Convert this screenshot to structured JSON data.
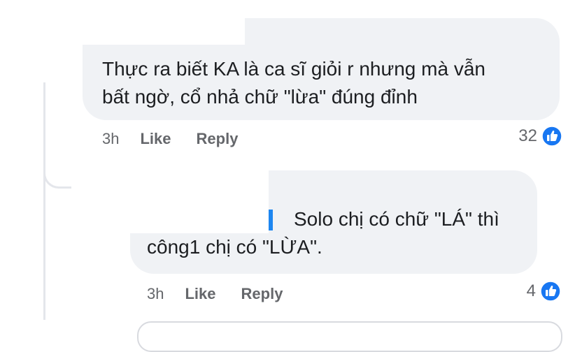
{
  "comments": [
    {
      "lines": [
        "Thực ra biết KA là ca sĩ giỏi r nhưng mà vẫn",
        "bất ngờ, cổ nhả chữ \"lừa\" đúng đỉnh"
      ],
      "time": "3h",
      "like_label": "Like",
      "reply_label": "Reply",
      "reaction_count": "32",
      "reaction_icon": "like-icon"
    },
    {
      "lines": [
        "Solo chị có chữ \"LÁ\" thì",
        "công1 chị có \"LỪA\"."
      ],
      "time": "3h",
      "like_label": "Like",
      "reply_label": "Reply",
      "reaction_count": "4",
      "reaction_icon": "like-icon"
    }
  ],
  "colors": {
    "bubble": "#f0f2f5",
    "meta_text": "#65676b",
    "like_blue": "#1877f2"
  }
}
